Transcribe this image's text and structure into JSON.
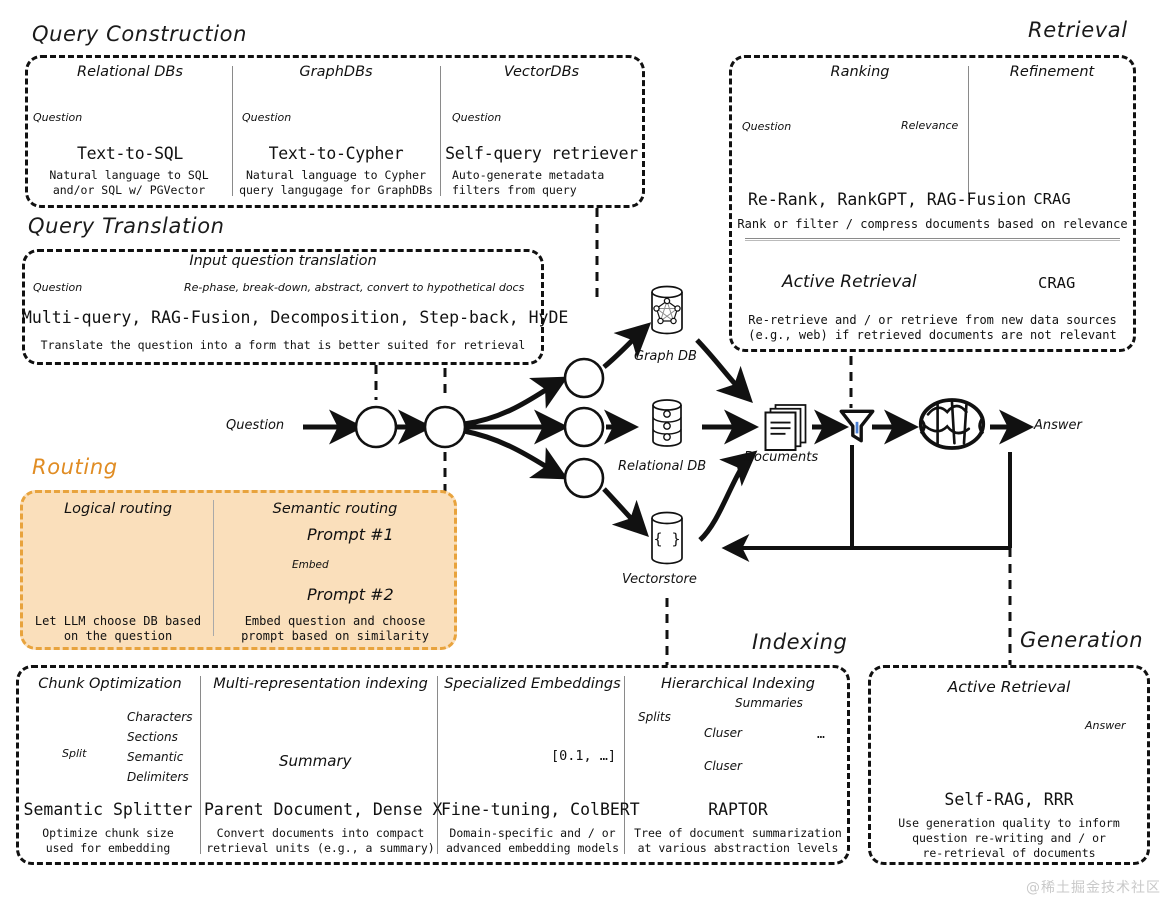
{
  "sections": {
    "query_construction": {
      "title": "Query Construction"
    },
    "query_translation": {
      "title": "Query Translation"
    },
    "routing": {
      "title": "Routing",
      "accent": "#E08C23",
      "fill": "#FADFBB",
      "border": "#E8A33D"
    },
    "retrieval": {
      "title": "Retrieval"
    },
    "indexing": {
      "title": "Indexing"
    },
    "generation": {
      "title": "Generation"
    }
  },
  "query_construction": {
    "panels": [
      {
        "head": "Relational DBs",
        "flow_label": "Question",
        "name": "Text-to-SQL",
        "desc": "Natural language to SQL\nand/or SQL w/ PGVector",
        "icon": "relational-db"
      },
      {
        "head": "GraphDBs",
        "flow_label": "Question",
        "name": "Text-to-Cypher",
        "desc": "Natural language to Cypher\nquery langugage for GraphDBs",
        "icon": "graph-db"
      },
      {
        "head": "VectorDBs",
        "flow_label": "Question",
        "name": "Self-query retriever",
        "desc": "Auto-generate metadata\nfilters from query",
        "icon": "vector-db"
      }
    ]
  },
  "query_translation": {
    "head": "Input question translation",
    "flow_label": "Question",
    "flow_out": "Re-phase, break-down, abstract, convert to hypothetical docs",
    "name": "Multi-query, RAG-Fusion, Decomposition, Step-back, HyDE",
    "desc": "Translate the question into a form that is better suited for retrieval"
  },
  "routing": {
    "panels": [
      {
        "head": "Logical routing",
        "desc": "Let LLM choose DB based\non the question"
      },
      {
        "head": "Semantic routing",
        "prompt1": "Prompt #1",
        "prompt2": "Prompt #2",
        "embed_label": "Embed",
        "desc": "Embed question and choose\nprompt based on similarity"
      }
    ]
  },
  "retrieval": {
    "ranking": {
      "head": "Ranking",
      "flow_label": "Question",
      "relevance_label": "Relevance",
      "name": "Re-Rank, RankGPT, RAG-Fusion"
    },
    "refinement": {
      "head": "Refinement",
      "name": "CRAG"
    },
    "shared_desc": "Rank or filter / compress documents based on relevance",
    "active": {
      "label": "Active Retrieval",
      "name": "CRAG",
      "desc": "Re-retrieve and / or retrieve from new data sources\n(e.g., web) if retrieved documents are not relevant"
    }
  },
  "indexing": {
    "panels": [
      {
        "head": "Chunk Optimization",
        "split_label": "Split",
        "items": [
          "Characters",
          "Sections",
          "Semantic",
          "Delimiters"
        ],
        "name": "Semantic Splitter",
        "desc": "Optimize chunk size\nused for embedding"
      },
      {
        "head": "Multi-representation indexing",
        "summary_label": "Summary",
        "name": "Parent Document, Dense X",
        "desc": "Convert documents into compact\nretrieval units (e.g., a summary)"
      },
      {
        "head": "Specialized Embeddings",
        "vector_label": "[0.1, …]",
        "name": "Fine-tuning, ColBERT",
        "desc": "Domain-specific and / or\nadvanced embedding models"
      },
      {
        "head": "Hierarchical Indexing",
        "splits_label": "Splits",
        "summaries_label": "Summaries",
        "cluster1": "Cluser",
        "cluster2": "Cluser",
        "ellipsis": "…",
        "name": "RAPTOR",
        "desc": "Tree of document summarization\nat various abstraction levels"
      }
    ]
  },
  "generation": {
    "head": "Active Retrieval",
    "answer_label": "Answer",
    "name": "Self-RAG, RRR",
    "desc": "Use generation quality to inform\nquestion re-writing and / or\nre-retrieval of documents"
  },
  "main_flow": {
    "question_label": "Question",
    "graph_db_label": "Graph DB",
    "relational_db_label": "Relational DB",
    "vectorstore_label": "Vectorstore",
    "documents_label": "Documents",
    "answer_label": "Answer"
  },
  "watermark": "@稀土掘金技术社区"
}
